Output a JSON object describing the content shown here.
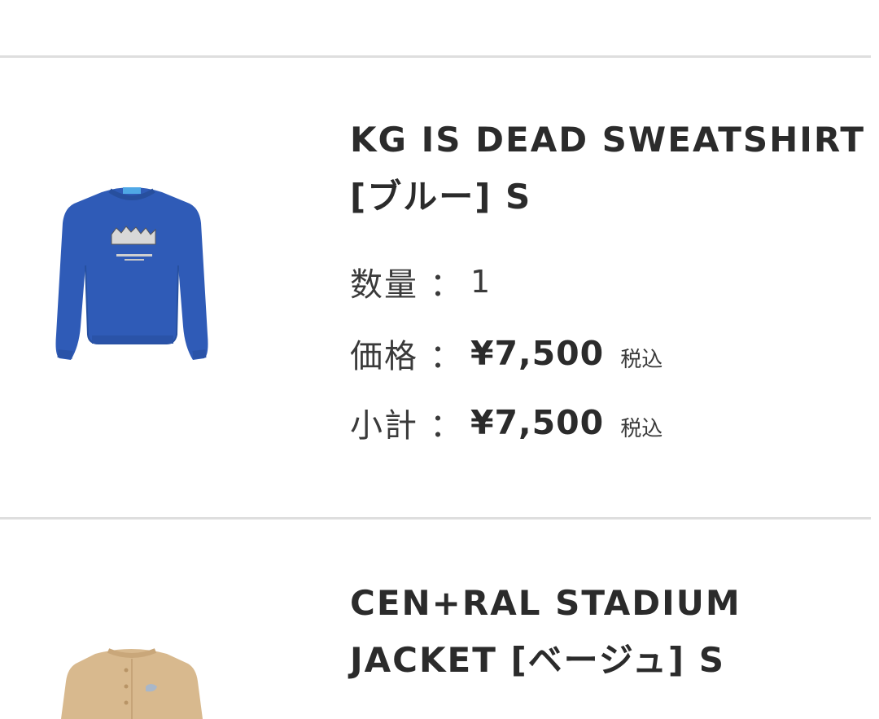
{
  "cart": {
    "items": [
      {
        "name_line1": "KG IS DEAD SWEATSHIRT",
        "name_line2": "[ブルー] S",
        "quantity_label": "数量",
        "quantity_colon": "：",
        "quantity": "1",
        "price_label": "価格",
        "price_colon": "：",
        "price": "¥7,500",
        "price_tax": "税込",
        "subtotal_label": "小計",
        "subtotal_colon": "：",
        "subtotal": "¥7,500",
        "subtotal_tax": "税込",
        "image_icon": "blue-sweatshirt-icon",
        "image_color": "#2f5bb7"
      },
      {
        "name_line1": "CEN+RAL STADIUM",
        "name_line2": "JACKET [ベージュ] S",
        "image_icon": "beige-jacket-icon",
        "image_color": "#d8b98e"
      }
    ]
  },
  "colors": {
    "divider": "#dedede",
    "text": "#2b2b2b"
  }
}
